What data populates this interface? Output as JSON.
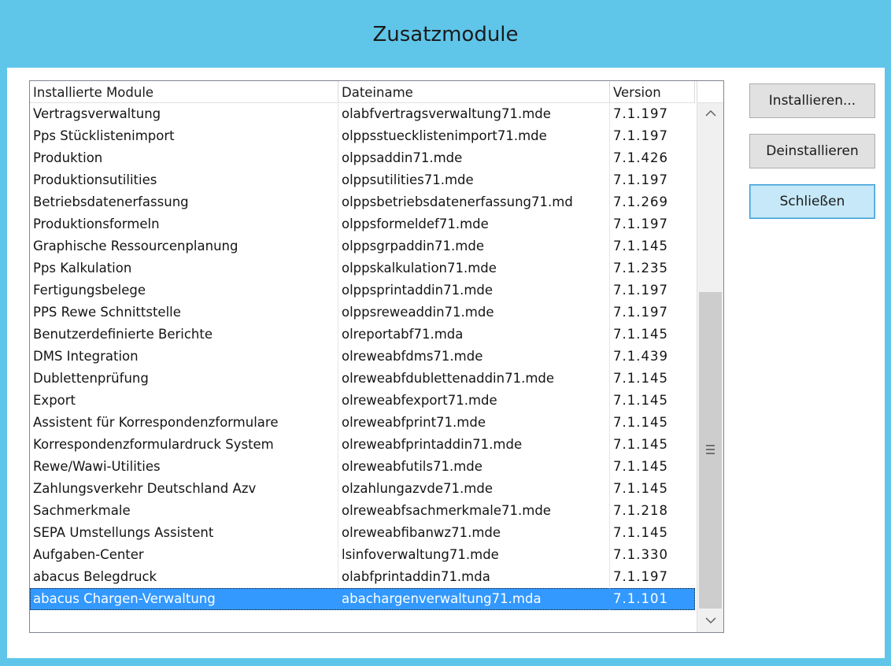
{
  "window": {
    "title": "Zusatzmodule"
  },
  "list": {
    "columns": [
      "Installierte Module",
      "Dateiname",
      "Version"
    ],
    "rows": [
      [
        "Vertragsverwaltung",
        "olabfvertragsverwaltung71.mde",
        "7.1.197"
      ],
      [
        "Pps Stücklistenimport",
        "olppsstuecklistenimport71.mde",
        "7.1.197"
      ],
      [
        "Produktion",
        "olppsaddin71.mde",
        "7.1.426"
      ],
      [
        "Produktionsutilities",
        "olppsutilities71.mde",
        "7.1.197"
      ],
      [
        "Betriebsdatenerfassung",
        "olppsbetriebsdatenerfassung71.md",
        "7.1.269"
      ],
      [
        "Produktionsformeln",
        "olppsformeldef71.mde",
        "7.1.197"
      ],
      [
        "Graphische Ressourcenplanung",
        "olppsgrpaddin71.mde",
        "7.1.145"
      ],
      [
        "Pps Kalkulation",
        "olppskalkulation71.mde",
        "7.1.235"
      ],
      [
        "Fertigungsbelege",
        "olppsprintaddin71.mde",
        "7.1.197"
      ],
      [
        "PPS Rewe Schnittstelle",
        "olppsreweaddin71.mde",
        "7.1.197"
      ],
      [
        "Benutzerdefinierte Berichte",
        "olreportabf71.mda",
        "7.1.145"
      ],
      [
        "DMS Integration",
        "olreweabfdms71.mde",
        "7.1.439"
      ],
      [
        "Dublettenprüfung",
        "olreweabfdublettenaddin71.mde",
        "7.1.145"
      ],
      [
        "Export",
        "olreweabfexport71.mde",
        "7.1.145"
      ],
      [
        "Assistent für Korrespondenzformulare",
        "olreweabfprint71.mde",
        "7.1.145"
      ],
      [
        "Korrespondenzformulardruck System",
        "olreweabfprintaddin71.mde",
        "7.1.145"
      ],
      [
        "Rewe/Wawi-Utilities",
        "olreweabfutils71.mde",
        "7.1.145"
      ],
      [
        "Zahlungsverkehr Deutschland Azv",
        "olzahlungazvde71.mde",
        "7.1.145"
      ],
      [
        "Sachmerkmale",
        "olreweabfsachmerkmale71.mde",
        "7.1.218"
      ],
      [
        "SEPA Umstellungs Assistent",
        "olreweabfibanwz71.mde",
        "7.1.145"
      ],
      [
        "Aufgaben-Center",
        "lsinfoverwaltung71.mde",
        "7.1.330"
      ],
      [
        "abacus Belegdruck",
        "olabfprintaddin71.mda",
        "7.1.197"
      ],
      [
        "abacus Chargen-Verwaltung",
        "abachargenverwaltung71.mda",
        "7.1.101"
      ]
    ],
    "selected_row_label": "abacus Chargen-Verwaltung"
  },
  "buttons": {
    "install": "Installieren...",
    "uninstall": "Deinstallieren",
    "close": "Schließen"
  },
  "scrollbar": {
    "up_icon": "chevron-up-icon",
    "down_icon": "chevron-down-icon",
    "grip_icon": "grip-icon"
  },
  "colors": {
    "titlebar": "#5fc6ea",
    "selection": "#3399ff",
    "default_button": "#c6e8f8"
  }
}
